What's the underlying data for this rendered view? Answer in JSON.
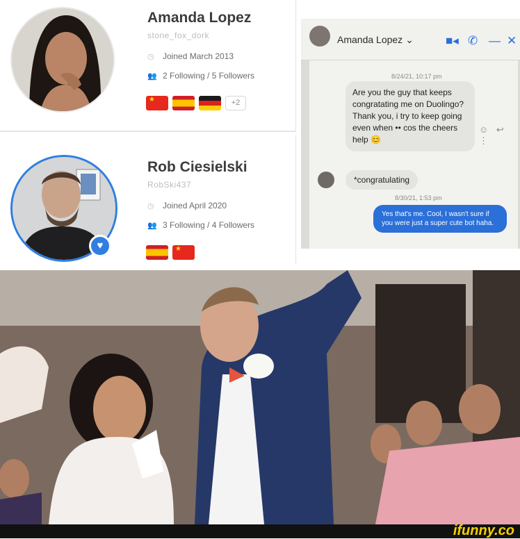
{
  "profiles": [
    {
      "name": "Amanda Lopez",
      "handle": "stone_fox_dork",
      "joined": "Joined March 2013",
      "follow": "2 Following / 5 Followers",
      "flags": [
        "flag-china",
        "flag-spain",
        "flag-germany"
      ],
      "more_flags": "+2"
    },
    {
      "name": "Rob Ciesielski",
      "handle": "RobSki437",
      "joined": "Joined April 2020",
      "follow": "3 Following / 4 Followers",
      "flags": [
        "flag-spain",
        "flag-china"
      ]
    }
  ],
  "chat": {
    "contact": "Amanda Lopez ⌄",
    "icons": [
      "video-call-icon",
      "phone-icon",
      "minimize-icon",
      "close-icon"
    ],
    "timestamp_1": "8/24/21, 10:17 pm",
    "message_1": "Are you the guy that keeps congratating me on Duolingo? Thank you, i try to keep going even when •• cos the cheers help 😊",
    "message_2": "*congratulating",
    "timestamp_2": "8/30/21, 1:53 pm",
    "message_3": "Yes that's me. Cool, I wasn't sure if you were just a super cute bot haha."
  },
  "watermark": "ifunny.co",
  "colors": {
    "accent_blue": "#2f7fe0",
    "chat_blue": "#2b6fd8",
    "watermark_yellow": "#f6d100"
  }
}
